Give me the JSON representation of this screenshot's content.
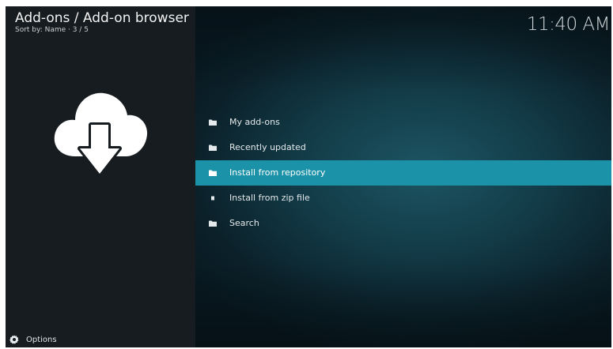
{
  "header": {
    "title": "Add-ons / Add-on browser",
    "subtitle": "Sort by: Name  ·  3 / 5"
  },
  "clock": "11:40 AM",
  "icons": {
    "hero": "cloud-download-icon",
    "folder": "folder-icon",
    "zip": "file-icon",
    "options": "gear-icon"
  },
  "menu": {
    "items": [
      {
        "label": "My add-ons",
        "icon": "folder-icon"
      },
      {
        "label": "Recently updated",
        "icon": "folder-icon"
      },
      {
        "label": "Install from repository",
        "icon": "folder-icon"
      },
      {
        "label": "Install from zip file",
        "icon": "file-icon"
      },
      {
        "label": "Search",
        "icon": "folder-icon"
      }
    ],
    "selected_index": 2
  },
  "footer": {
    "options_label": "Options"
  },
  "colors": {
    "highlight": "#1c92a8",
    "left_panel": "#161c20",
    "background": "#123a46"
  }
}
